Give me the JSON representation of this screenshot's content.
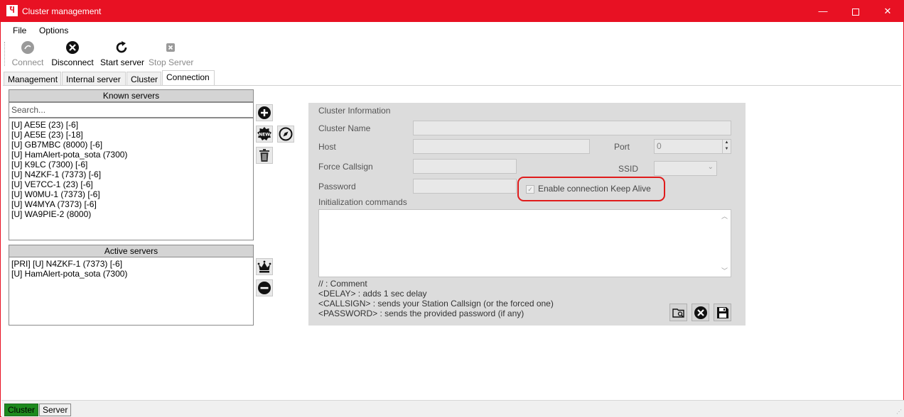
{
  "window": {
    "title": "Cluster management",
    "icon_text": "Ⴏ",
    "controls": {
      "minimize": "—",
      "close": "✕"
    }
  },
  "menu": {
    "file": "File",
    "options": "Options"
  },
  "toolbar": {
    "connect": "Connect",
    "disconnect": "Disconnect",
    "start_server": "Start server",
    "stop_server": "Stop Server"
  },
  "tabs": [
    {
      "label": "Management",
      "active": false
    },
    {
      "label": "Internal server",
      "active": false
    },
    {
      "label": "Cluster",
      "active": false
    },
    {
      "label": "Connection",
      "active": true
    }
  ],
  "known_servers": {
    "header": "Known servers",
    "search_placeholder": "Search...",
    "items": [
      "[U] AE5E (23) [-6]",
      "[U] AE5E (23) [-18]",
      "[U] GB7MBC (8000) [-6]",
      "[U] HamAlert-pota_sota (7300)",
      "[U] K9LC (7300) [-6]",
      "[U] N4ZKF-1 (7373) [-6]",
      "[U] VE7CC-1 (23) [-6]",
      "[U] W0MU-1 (7373) [-6]",
      "[U] W4MYA (7373) [-6]",
      "[U] WA9PIE-2 (8000)"
    ]
  },
  "active_servers": {
    "header": "Active servers",
    "items": [
      "[PRI] [U] N4ZKF-1 (7373) [-6]",
      "[U] HamAlert-pota_sota (7300)"
    ]
  },
  "cluster_info": {
    "section_title": "Cluster Information",
    "cluster_name_label": "Cluster Name",
    "cluster_name_value": "",
    "host_label": "Host",
    "host_value": "",
    "port_label": "Port",
    "port_value": "0",
    "force_callsign_label": "Force Callsign",
    "force_callsign_value": "",
    "ssid_label": "SSID",
    "password_label": "Password",
    "password_value": "",
    "keep_alive_label": "Enable connection Keep Alive",
    "keep_alive_checked": true,
    "init_commands_label": "Initialization commands",
    "init_commands_value": "",
    "help": [
      "// : Comment",
      "<DELAY> : adds 1 sec delay",
      "<CALLSIGN> : sends your Station Callsign (or the forced one)",
      "<PASSWORD> : sends the provided password (if any)"
    ]
  },
  "statusbar": {
    "cluster": "Cluster",
    "server": "Server"
  },
  "colors": {
    "titlebar": "#e81123",
    "highlight_ring": "#e01b1b",
    "status_cluster": "#1e8a1e"
  }
}
